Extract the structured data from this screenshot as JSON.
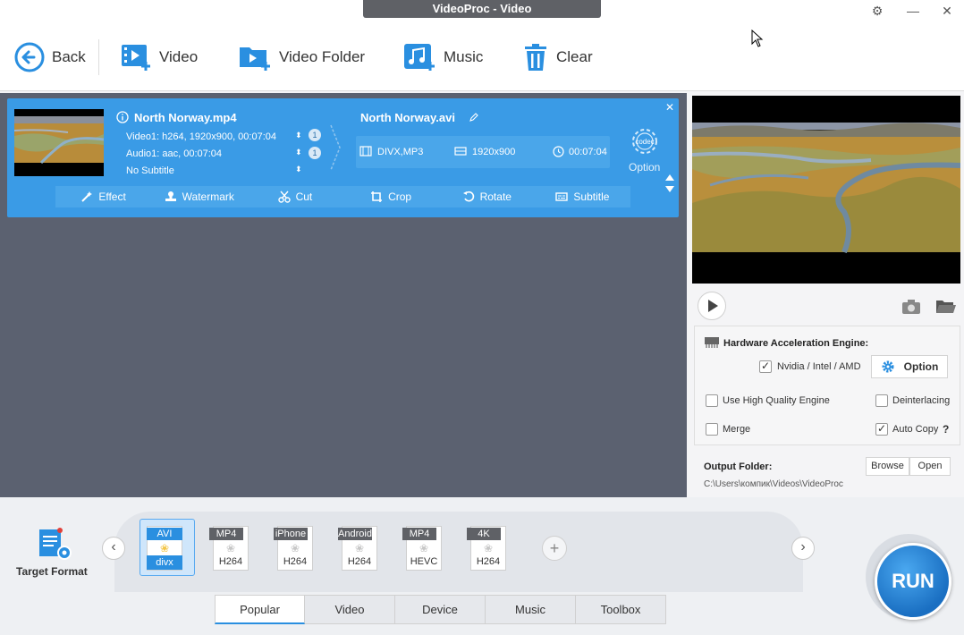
{
  "window": {
    "title": "VideoProc - Video",
    "controls": {
      "settings": "⚙",
      "minimize": "—",
      "close": "✕"
    }
  },
  "toolbar": {
    "back_label": "Back",
    "video_label": "Video",
    "video_folder_label": "Video Folder",
    "music_label": "Music",
    "clear_label": "Clear"
  },
  "item": {
    "source_name": "North Norway.mp4",
    "video_track": "Video1: h264, 1920x900, 00:07:04",
    "audio_track": "Audio1: aac, 00:07:04",
    "subtitle_track": "No Subtitle",
    "video_track_count": "1",
    "audio_track_count": "1",
    "output_name": "North Norway.avi",
    "output_codecs": "DIVX,MP3",
    "output_resolution": "1920x900",
    "output_duration": "00:07:04",
    "codec_badge": "codec",
    "codec_option_label": "Option",
    "close": "✕",
    "actions": {
      "effect": "Effect",
      "watermark": "Watermark",
      "cut": "Cut",
      "crop": "Crop",
      "rotate": "Rotate",
      "subtitle": "Subtitle"
    }
  },
  "hardware": {
    "title": "Hardware Acceleration Engine:",
    "gpu_label": "Nvidia / Intel / AMD",
    "gpu_checked": true,
    "option_label": "Option",
    "high_quality_label": "Use High Quality Engine",
    "high_quality_checked": false,
    "deinterlacing_label": "Deinterlacing",
    "deinterlacing_checked": false,
    "merge_label": "Merge",
    "merge_checked": false,
    "auto_copy_label": "Auto Copy",
    "auto_copy_checked": true,
    "help": "?"
  },
  "output": {
    "label": "Output Folder:",
    "browse_label": "Browse",
    "open_label": "Open",
    "path": "C:\\Users\\компик\\Videos\\VideoProc"
  },
  "target_format": {
    "label": "Target Format",
    "formats": [
      {
        "tag": "AVI",
        "codec": "divx",
        "selected": true
      },
      {
        "tag": "MP4",
        "codec": "H264",
        "selected": false
      },
      {
        "tag": "iPhone",
        "codec": "H264",
        "selected": false
      },
      {
        "tag": "Android",
        "codec": "H264",
        "selected": false
      },
      {
        "tag": "MP4",
        "codec": "HEVC",
        "selected": false
      },
      {
        "tag": "4K",
        "codec": "H264",
        "selected": false
      }
    ],
    "add": "+",
    "prev": "‹",
    "next": "›"
  },
  "tabs": {
    "popular": "Popular",
    "video": "Video",
    "device": "Device",
    "music": "Music",
    "toolbox": "Toolbox",
    "active": "Popular"
  },
  "run_label": "RUN",
  "colors": {
    "accent": "#3a9be6",
    "list_bg": "#5b6170",
    "run_blue": "#1a6fc2"
  }
}
